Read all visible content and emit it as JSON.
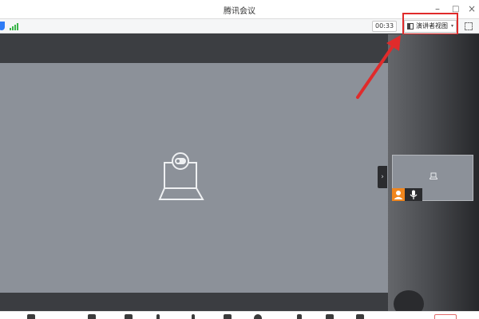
{
  "window": {
    "title": "腾讯会议",
    "controls": {
      "minimize": "–",
      "maximize": "□",
      "close": "×"
    }
  },
  "toolbar": {
    "timer": "00:33",
    "view_button_label": "演讲者视图",
    "view_caret": "▾"
  },
  "right_panel": {
    "collapse_glyph": "›"
  },
  "colors": {
    "stage": "#8c9199",
    "annotation_red": "#e02b2b",
    "user_badge": "#f0861e",
    "signal": "#3bb54a",
    "shield": "#2e7cf6"
  },
  "icons": [
    "shield-icon",
    "signal-icon",
    "layout-icon",
    "fullscreen-icon",
    "laptop-camera-icon",
    "user-icon",
    "mic-icon"
  ]
}
